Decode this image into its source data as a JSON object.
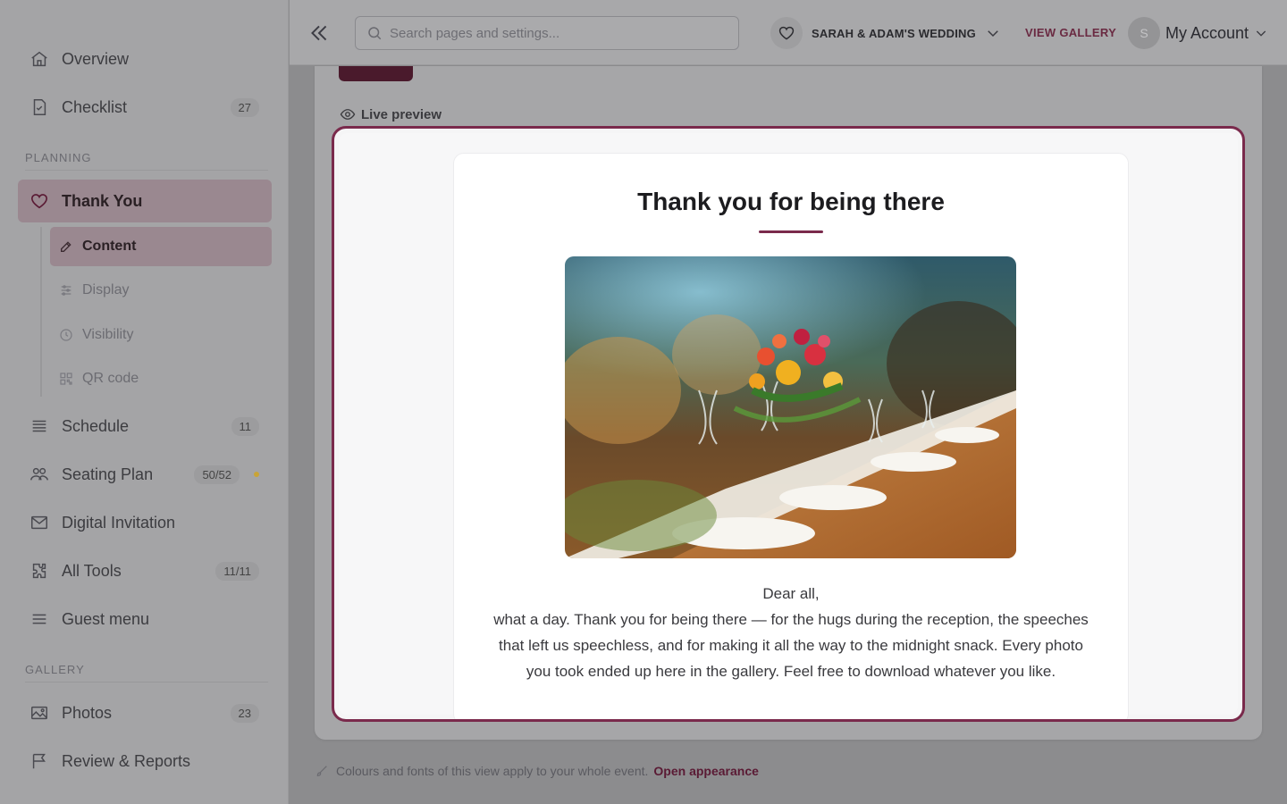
{
  "sidebar": {
    "items": [
      {
        "label": "Overview",
        "icon": "home-icon"
      },
      {
        "label": "Checklist",
        "icon": "checklist-icon",
        "badge": "27"
      },
      {
        "label": "Thank You",
        "icon": "heart-icon",
        "active": true
      },
      {
        "label": "Schedule",
        "icon": "schedule-icon",
        "badge": "11"
      },
      {
        "label": "Seating Plan",
        "icon": "seating-icon",
        "badge": "50/52"
      },
      {
        "label": "Digital Invitation",
        "icon": "envelope-icon"
      },
      {
        "label": "All Tools",
        "icon": "puzzle-icon",
        "badge": "11/11"
      },
      {
        "label": "Guest menu",
        "icon": "menu-icon"
      },
      {
        "label": "Photos",
        "icon": "image-icon",
        "badge": "23"
      },
      {
        "label": "Review & Reports",
        "icon": "flag-icon"
      }
    ],
    "sections": {
      "planning": "PLANNING",
      "gallery": "GALLERY"
    },
    "sub_items": [
      {
        "label": "Content",
        "icon": "edit-icon",
        "active": true
      },
      {
        "label": "Display",
        "icon": "sliders-icon"
      },
      {
        "label": "Visibility",
        "icon": "clock-icon"
      },
      {
        "label": "QR code",
        "icon": "qr-icon"
      }
    ]
  },
  "header": {
    "search_placeholder": "Search pages and settings...",
    "event_name": "SARAH & ADAM'S WEDDING",
    "view_gallery": "VIEW GALLERY",
    "avatar_initial": "S",
    "account_label": "My Account"
  },
  "main": {
    "live_preview_label": "Live preview",
    "preview": {
      "title": "Thank you for being there",
      "greeting": "Dear all,",
      "body": "what a day. Thank you for being there — for the hugs during the reception, the speeches that left us speechless, and for making it all the way to the midnight snack. Every photo you took ended up here in the gallery. Feel free to download whatever you like."
    },
    "footer_note": "Colours and fonts of this view apply to your whole event.",
    "footer_link": "Open appearance"
  },
  "colors": {
    "accent": "#7a2a4c",
    "overlay": "#8c8c8e",
    "badge_dot": "#c9a436"
  }
}
